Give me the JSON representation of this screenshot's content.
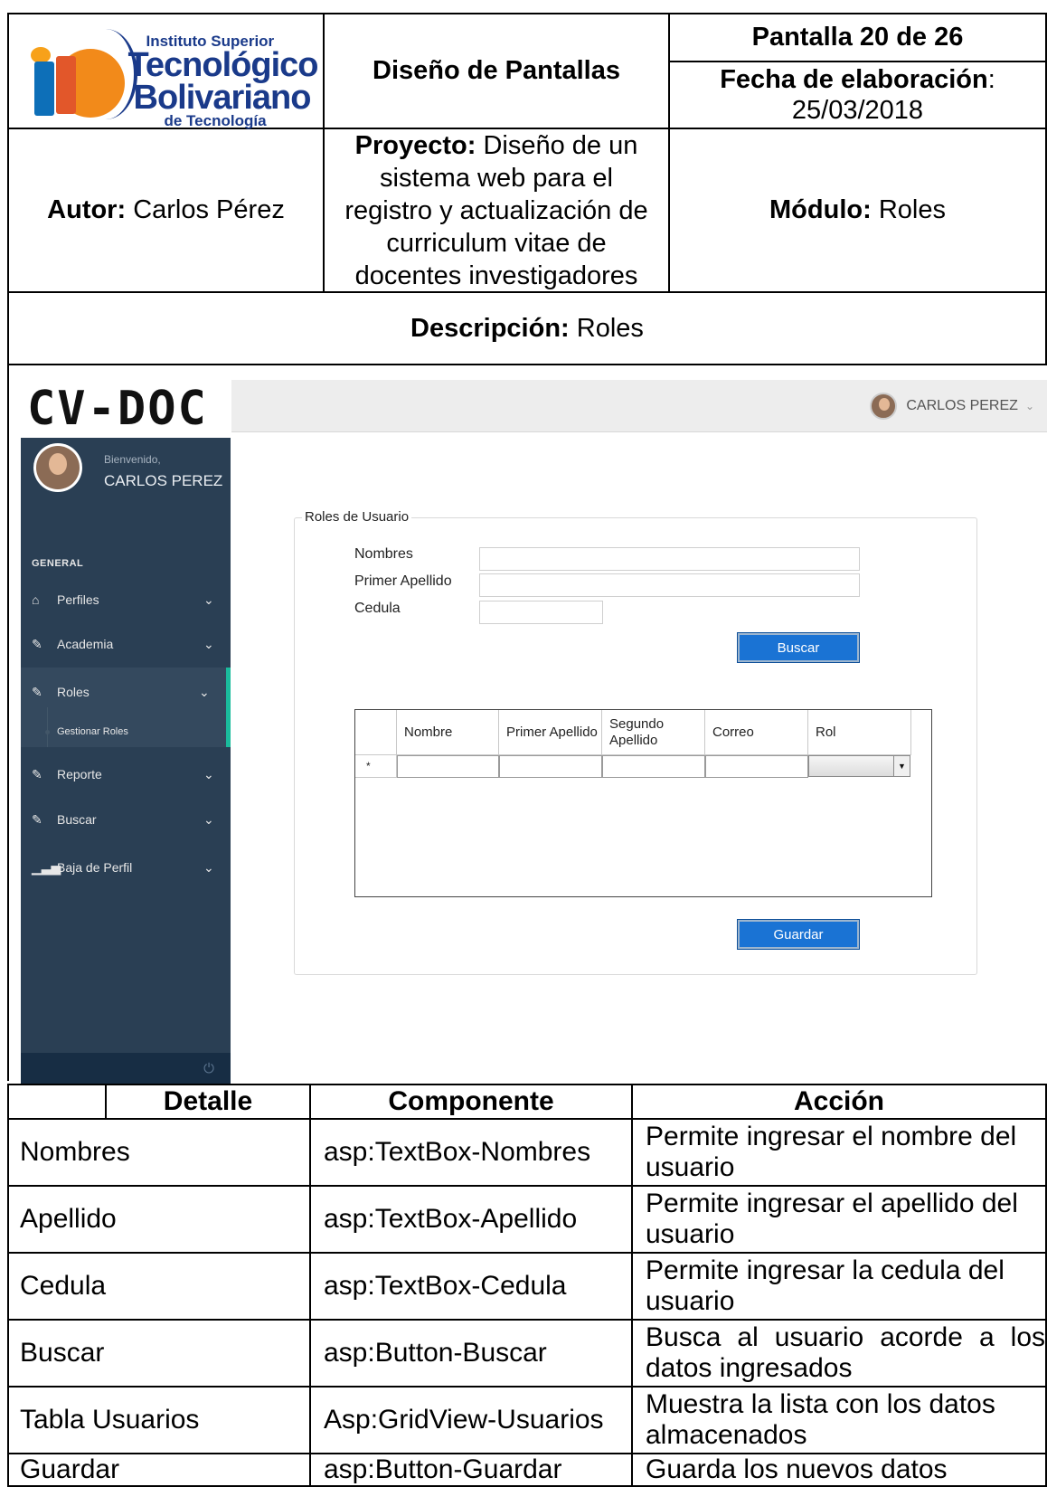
{
  "header": {
    "logo": {
      "line1": "Instituto Superior",
      "line2": "Tecnológico",
      "line3": "Bolivariano",
      "line4": "de Tecnología"
    },
    "title": "Diseño de Pantallas",
    "screen_no": "Pantalla 20 de 26",
    "date_label": "Fecha de elaboración",
    "date_colon": ":",
    "date_value": "25/03/2018",
    "author_label": "Autor:",
    "author_value": "Carlos Pérez",
    "project_label": "Proyecto:",
    "project_value": "Diseño de un sistema web para el registro y actualización de curriculum vitae de docentes investigadores",
    "module_label": "Módulo:",
    "module_value": "Roles",
    "description_label": "Descripción:",
    "description_value": "Roles"
  },
  "app": {
    "brand": "CV-DOC",
    "topbar": {
      "user": "CARLOS PEREZ",
      "chevron": "⌄"
    },
    "sidebar": {
      "welcome": "Bienvenido,",
      "user": "CARLOS PEREZ",
      "section": "GENERAL",
      "items": [
        {
          "label": "Perfiles",
          "icon": "home-icon"
        },
        {
          "label": "Academia",
          "icon": "edit-icon"
        },
        {
          "label": "Roles",
          "icon": "edit-icon"
        },
        {
          "label": "Reporte",
          "icon": "edit-icon"
        },
        {
          "label": "Buscar",
          "icon": "edit-icon"
        },
        {
          "label": "Baja de Perfil",
          "icon": "bar-chart-icon"
        }
      ],
      "subitem": "Gestionar Roles",
      "power": "⏻",
      "colors": {
        "bg": "#2a3f54",
        "accent": "#1abb9c"
      }
    },
    "form": {
      "legend": "Roles de Usuario",
      "nombres_label": "Nombres",
      "apellido_label": "Primer Apellido",
      "cedula_label": "Cedula",
      "nombres_value": "",
      "apellido_value": "",
      "cedula_value": "",
      "buscar": "Buscar",
      "guardar": "Guardar"
    },
    "grid": {
      "columns": [
        "Nombre",
        "Primer Apellido",
        "Segundo Apellido",
        "Correo",
        "Rol"
      ],
      "new_row_marker": "*"
    }
  },
  "details": {
    "headers": [
      "Detalle",
      "Componente",
      "Acción"
    ],
    "rows": [
      {
        "detalle": "Nombres",
        "componente": "asp:TextBox-Nombres",
        "accion": "Permite ingresar el nombre del usuario"
      },
      {
        "detalle": "Apellido",
        "componente": "asp:TextBox-Apellido",
        "accion": "Permite ingresar el apellido del usuario"
      },
      {
        "detalle": "Cedula",
        "componente": "asp:TextBox-Cedula",
        "accion": "Permite ingresar la cedula del usuario"
      },
      {
        "detalle": "Buscar",
        "componente": "asp:Button-Buscar",
        "accion": "Busca al usuario acorde a los datos ingresados"
      },
      {
        "detalle": "Tabla Usuarios",
        "componente": "Asp:GridView-Usuarios",
        "accion": "Muestra la lista con los datos almacenados"
      },
      {
        "detalle": "Guardar",
        "componente": "asp:Button-Guardar",
        "accion": "Guarda los nuevos datos"
      }
    ]
  }
}
